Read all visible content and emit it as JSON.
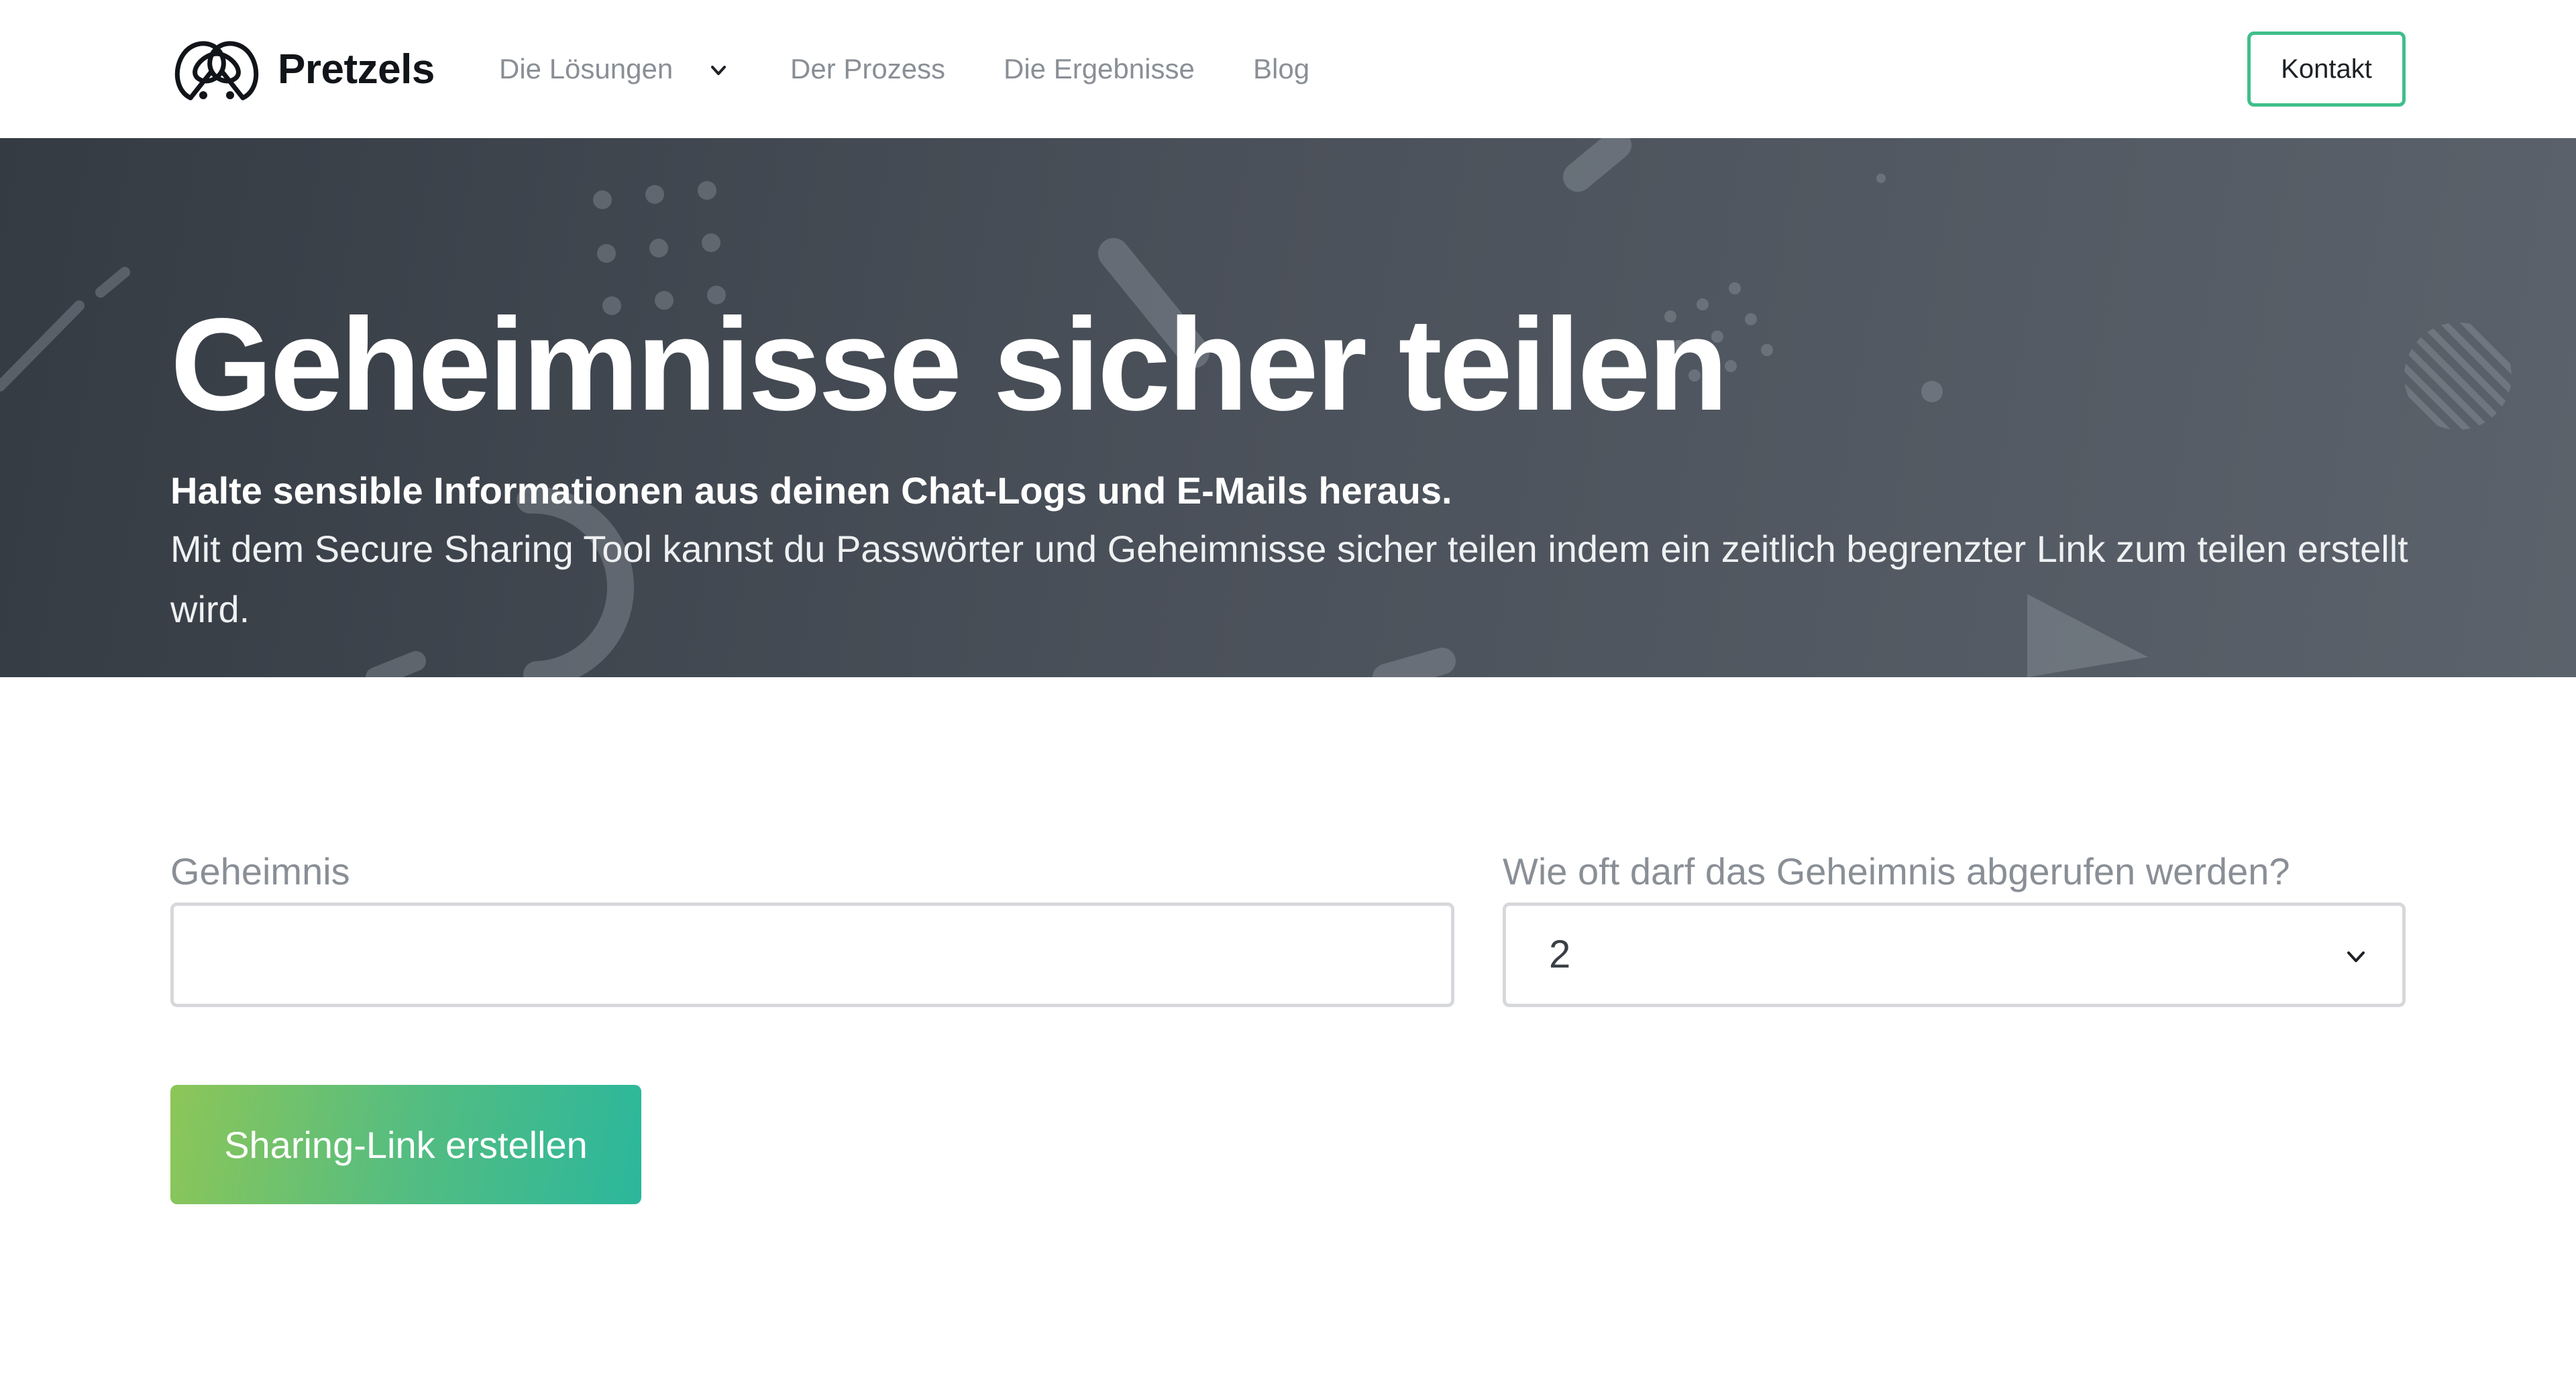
{
  "brand": {
    "name": "Pretzels",
    "logo_icon": "pretzel-icon"
  },
  "nav": {
    "items": [
      {
        "label": "Die Lösungen",
        "has_dropdown": true
      },
      {
        "label": "Der Prozess"
      },
      {
        "label": "Die Ergebnisse"
      },
      {
        "label": "Blog"
      }
    ],
    "contact_label": "Kontakt"
  },
  "hero": {
    "title": "Geheimnisse sicher teilen",
    "subtitle": "Halte sensible Informationen aus deinen Chat-Logs und E-Mails heraus.",
    "description": "Mit dem Secure Sharing Tool kannst du Passwörter und Geheimnisse sicher teilen indem ein zeitlich begrenzter Link zum teilen erstellt wird."
  },
  "form": {
    "secret": {
      "label": "Geheimnis",
      "value": "",
      "placeholder": ""
    },
    "views": {
      "label": "Wie oft darf das Geheimnis abgerufen werden?",
      "selected": "2"
    },
    "submit_label": "Sharing-Link erstellen"
  },
  "colors": {
    "accent_green": "#3fbf8a",
    "button_gradient_start": "#8dc658",
    "button_gradient_end": "#2bb79c",
    "hero_bg": "#4a5059"
  }
}
